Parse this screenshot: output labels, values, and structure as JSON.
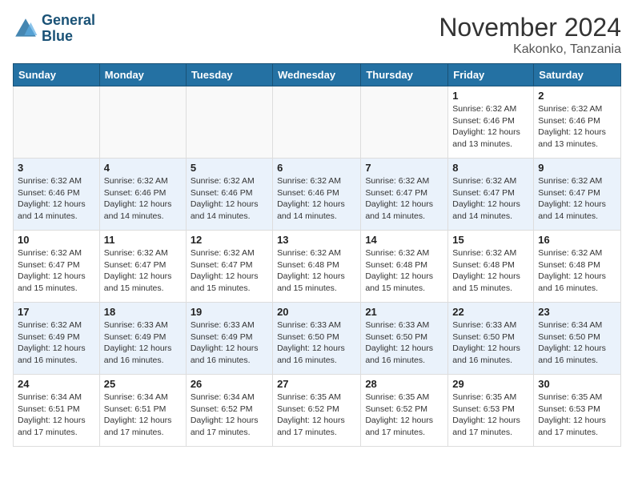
{
  "logo": {
    "line1": "General",
    "line2": "Blue"
  },
  "title": "November 2024",
  "location": "Kakonko, Tanzania",
  "days_of_week": [
    "Sunday",
    "Monday",
    "Tuesday",
    "Wednesday",
    "Thursday",
    "Friday",
    "Saturday"
  ],
  "weeks": [
    [
      {
        "day": "",
        "info": ""
      },
      {
        "day": "",
        "info": ""
      },
      {
        "day": "",
        "info": ""
      },
      {
        "day": "",
        "info": ""
      },
      {
        "day": "",
        "info": ""
      },
      {
        "day": "1",
        "info": "Sunrise: 6:32 AM\nSunset: 6:46 PM\nDaylight: 12 hours\nand 13 minutes."
      },
      {
        "day": "2",
        "info": "Sunrise: 6:32 AM\nSunset: 6:46 PM\nDaylight: 12 hours\nand 13 minutes."
      }
    ],
    [
      {
        "day": "3",
        "info": "Sunrise: 6:32 AM\nSunset: 6:46 PM\nDaylight: 12 hours\nand 14 minutes."
      },
      {
        "day": "4",
        "info": "Sunrise: 6:32 AM\nSunset: 6:46 PM\nDaylight: 12 hours\nand 14 minutes."
      },
      {
        "day": "5",
        "info": "Sunrise: 6:32 AM\nSunset: 6:46 PM\nDaylight: 12 hours\nand 14 minutes."
      },
      {
        "day": "6",
        "info": "Sunrise: 6:32 AM\nSunset: 6:46 PM\nDaylight: 12 hours\nand 14 minutes."
      },
      {
        "day": "7",
        "info": "Sunrise: 6:32 AM\nSunset: 6:47 PM\nDaylight: 12 hours\nand 14 minutes."
      },
      {
        "day": "8",
        "info": "Sunrise: 6:32 AM\nSunset: 6:47 PM\nDaylight: 12 hours\nand 14 minutes."
      },
      {
        "day": "9",
        "info": "Sunrise: 6:32 AM\nSunset: 6:47 PM\nDaylight: 12 hours\nand 14 minutes."
      }
    ],
    [
      {
        "day": "10",
        "info": "Sunrise: 6:32 AM\nSunset: 6:47 PM\nDaylight: 12 hours\nand 15 minutes."
      },
      {
        "day": "11",
        "info": "Sunrise: 6:32 AM\nSunset: 6:47 PM\nDaylight: 12 hours\nand 15 minutes."
      },
      {
        "day": "12",
        "info": "Sunrise: 6:32 AM\nSunset: 6:47 PM\nDaylight: 12 hours\nand 15 minutes."
      },
      {
        "day": "13",
        "info": "Sunrise: 6:32 AM\nSunset: 6:48 PM\nDaylight: 12 hours\nand 15 minutes."
      },
      {
        "day": "14",
        "info": "Sunrise: 6:32 AM\nSunset: 6:48 PM\nDaylight: 12 hours\nand 15 minutes."
      },
      {
        "day": "15",
        "info": "Sunrise: 6:32 AM\nSunset: 6:48 PM\nDaylight: 12 hours\nand 15 minutes."
      },
      {
        "day": "16",
        "info": "Sunrise: 6:32 AM\nSunset: 6:48 PM\nDaylight: 12 hours\nand 16 minutes."
      }
    ],
    [
      {
        "day": "17",
        "info": "Sunrise: 6:32 AM\nSunset: 6:49 PM\nDaylight: 12 hours\nand 16 minutes."
      },
      {
        "day": "18",
        "info": "Sunrise: 6:33 AM\nSunset: 6:49 PM\nDaylight: 12 hours\nand 16 minutes."
      },
      {
        "day": "19",
        "info": "Sunrise: 6:33 AM\nSunset: 6:49 PM\nDaylight: 12 hours\nand 16 minutes."
      },
      {
        "day": "20",
        "info": "Sunrise: 6:33 AM\nSunset: 6:50 PM\nDaylight: 12 hours\nand 16 minutes."
      },
      {
        "day": "21",
        "info": "Sunrise: 6:33 AM\nSunset: 6:50 PM\nDaylight: 12 hours\nand 16 minutes."
      },
      {
        "day": "22",
        "info": "Sunrise: 6:33 AM\nSunset: 6:50 PM\nDaylight: 12 hours\nand 16 minutes."
      },
      {
        "day": "23",
        "info": "Sunrise: 6:34 AM\nSunset: 6:50 PM\nDaylight: 12 hours\nand 16 minutes."
      }
    ],
    [
      {
        "day": "24",
        "info": "Sunrise: 6:34 AM\nSunset: 6:51 PM\nDaylight: 12 hours\nand 17 minutes."
      },
      {
        "day": "25",
        "info": "Sunrise: 6:34 AM\nSunset: 6:51 PM\nDaylight: 12 hours\nand 17 minutes."
      },
      {
        "day": "26",
        "info": "Sunrise: 6:34 AM\nSunset: 6:52 PM\nDaylight: 12 hours\nand 17 minutes."
      },
      {
        "day": "27",
        "info": "Sunrise: 6:35 AM\nSunset: 6:52 PM\nDaylight: 12 hours\nand 17 minutes."
      },
      {
        "day": "28",
        "info": "Sunrise: 6:35 AM\nSunset: 6:52 PM\nDaylight: 12 hours\nand 17 minutes."
      },
      {
        "day": "29",
        "info": "Sunrise: 6:35 AM\nSunset: 6:53 PM\nDaylight: 12 hours\nand 17 minutes."
      },
      {
        "day": "30",
        "info": "Sunrise: 6:35 AM\nSunset: 6:53 PM\nDaylight: 12 hours\nand 17 minutes."
      }
    ]
  ]
}
